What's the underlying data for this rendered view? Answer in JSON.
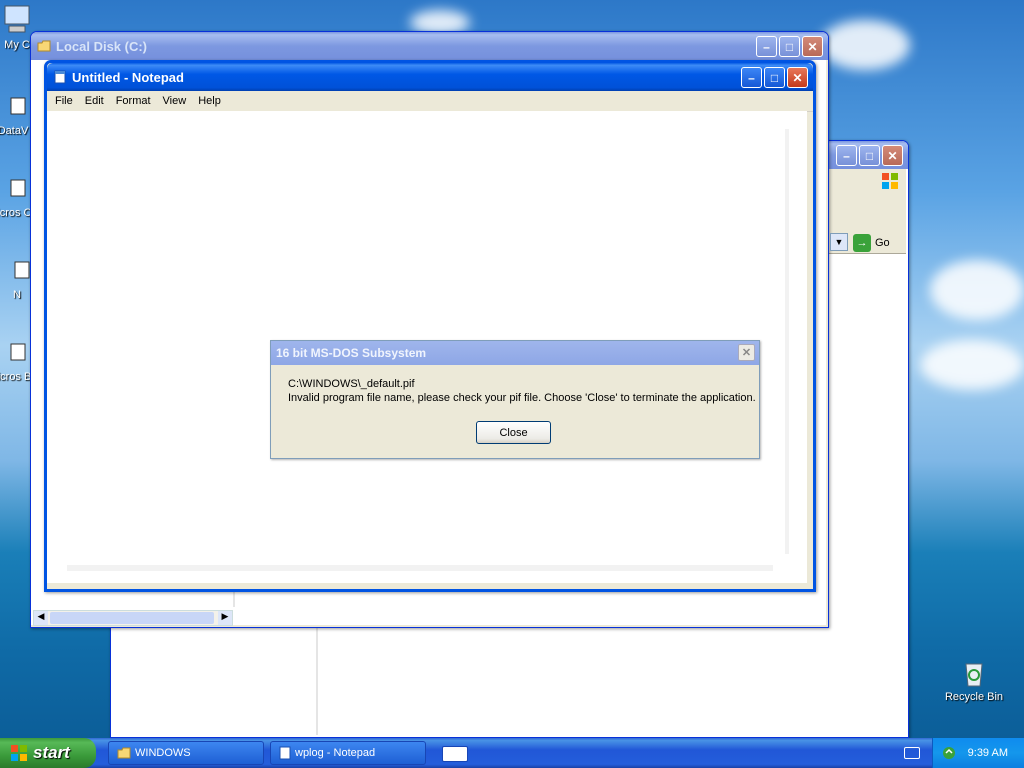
{
  "desktop": {
    "icons": [
      {
        "label": "My C"
      },
      {
        "label": "DataV"
      },
      {
        "label": "Micros C+"
      },
      {
        "label": "N"
      },
      {
        "label": "Micros Ba"
      },
      {
        "label": "Recycle Bin"
      }
    ]
  },
  "explorer_window": {
    "title": "Local Disk (C:)",
    "go_label": "Go"
  },
  "back_window": {},
  "notepad": {
    "title": "Untitled - Notepad",
    "menu": [
      "File",
      "Edit",
      "Format",
      "View",
      "Help"
    ]
  },
  "dialog": {
    "title": "16 bit MS-DOS Subsystem",
    "line1": "C:\\WINDOWS\\_default.pif",
    "line2": "Invalid program file name, please check your pif file. Choose 'Close' to terminate the application.",
    "button": "Close"
  },
  "taskbar": {
    "start_label": "start",
    "tasks": [
      "WINDOWS",
      "wplog - Notepad"
    ],
    "clock": "9:39 AM"
  },
  "colors": {
    "title_active": "#0058e6",
    "title_inactive": "#7d98e0",
    "window_face": "#ece9d8",
    "start_green": "#3a9a3a"
  }
}
